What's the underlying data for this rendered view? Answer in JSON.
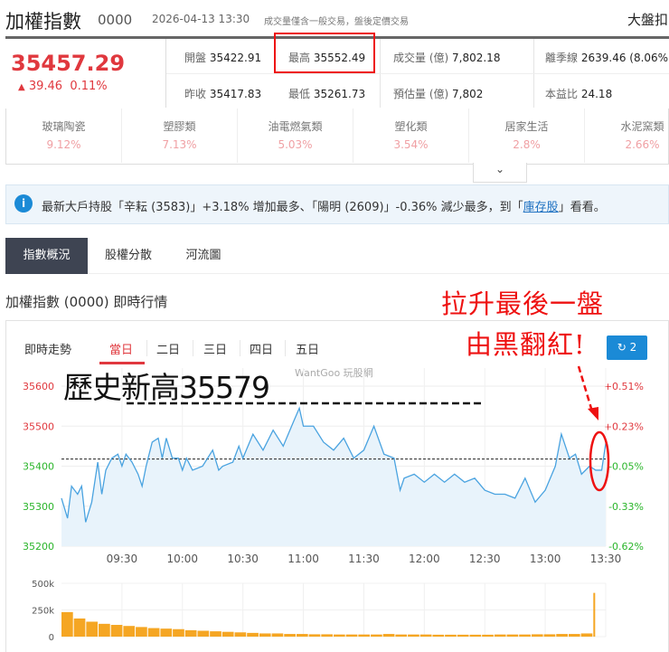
{
  "header": {
    "title": "加權指數",
    "code": "0000",
    "timestamp": "2026-04-13 13:30",
    "note": "成交量僅含一般交易，盤後定價交易",
    "right_cut": "大盤扣"
  },
  "quote": {
    "price": "35457.29",
    "change_arrow": "▲",
    "change": "39.46",
    "change_pct": "0.11%"
  },
  "stats": [
    {
      "label": "開盤",
      "value": "35422.91"
    },
    {
      "label": "最高",
      "value": "35552.49"
    },
    {
      "label": "成交量 (億)",
      "value": "7,802.18"
    },
    {
      "label": "離季線",
      "value": "2639.46 (8.06%"
    },
    {
      "label": "昨收",
      "value": "35417.83"
    },
    {
      "label": "最低",
      "value": "35261.73"
    },
    {
      "label": "預估量 (億)",
      "value": "7,802"
    },
    {
      "label": "本益比",
      "value": "24.18"
    }
  ],
  "sectors": [
    {
      "name": "玻璃陶瓷",
      "pct": "9.12%"
    },
    {
      "name": "塑膠類",
      "pct": "7.13%"
    },
    {
      "name": "油電燃氣類",
      "pct": "5.03%"
    },
    {
      "name": "塑化類",
      "pct": "3.54%"
    },
    {
      "name": "居家生活",
      "pct": "2.8%"
    },
    {
      "name": "水泥窯類",
      "pct": "2.66%"
    }
  ],
  "expand_icon": "chevron-down-icon",
  "info": {
    "icon": "i",
    "pre": "最新大戶持股「辛耘 (3583)」+3.18% 增加最多、「陽明 (2609)」-0.36% 減少最多，到「",
    "link": "庫存股",
    "post": "」看看。"
  },
  "tabs": [
    "指數概況",
    "股權分散",
    "河流圖"
  ],
  "section_title": "加權指數 (0000) 即時行情",
  "chart_header": {
    "label": "即時走勢",
    "ranges": [
      "當日",
      "二日",
      "三日",
      "四日",
      "五日"
    ],
    "refresh": "2"
  },
  "watermark": "WantGoo 玩股網",
  "annotations": {
    "high": "歷史新高35579",
    "line1": "拉升最後一盤",
    "line2": "由黑翻紅!"
  },
  "colors": {
    "up": "#e0383e",
    "down": "#2bb52b",
    "line": "#4aa3e0",
    "volume": "#f5a623",
    "accent": "#1b8ad6"
  },
  "chart_data": {
    "type": "line",
    "title": "即時走勢",
    "prev_close": 35417.83,
    "ylim": [
      35200,
      35600
    ],
    "y_ticks": [
      "35600",
      "35500",
      "35400",
      "35300",
      "35200"
    ],
    "y_pct_ticks": [
      "+0.51%",
      "+0.23%",
      "-0.05%",
      "-0.33%",
      "-0.62%"
    ],
    "x_ticks": [
      "09:30",
      "10:00",
      "10:30",
      "11:00",
      "11:30",
      "12:00",
      "12:30",
      "13:00",
      "13:30"
    ],
    "x_minutes_range": [
      0,
      270
    ],
    "series": [
      {
        "name": "加權指數",
        "points": [
          [
            0,
            35320
          ],
          [
            3,
            35270
          ],
          [
            5,
            35350
          ],
          [
            8,
            35330
          ],
          [
            10,
            35350
          ],
          [
            12,
            35260
          ],
          [
            15,
            35310
          ],
          [
            18,
            35410
          ],
          [
            20,
            35330
          ],
          [
            22,
            35390
          ],
          [
            25,
            35420
          ],
          [
            28,
            35430
          ],
          [
            30,
            35400
          ],
          [
            32,
            35430
          ],
          [
            35,
            35410
          ],
          [
            38,
            35380
          ],
          [
            40,
            35350
          ],
          [
            42,
            35400
          ],
          [
            45,
            35460
          ],
          [
            48,
            35470
          ],
          [
            50,
            35420
          ],
          [
            52,
            35470
          ],
          [
            55,
            35420
          ],
          [
            58,
            35420
          ],
          [
            60,
            35390
          ],
          [
            62,
            35420
          ],
          [
            65,
            35390
          ],
          [
            70,
            35400
          ],
          [
            75,
            35440
          ],
          [
            78,
            35390
          ],
          [
            80,
            35400
          ],
          [
            85,
            35410
          ],
          [
            88,
            35450
          ],
          [
            90,
            35420
          ],
          [
            95,
            35480
          ],
          [
            100,
            35440
          ],
          [
            105,
            35490
          ],
          [
            110,
            35450
          ],
          [
            115,
            35510
          ],
          [
            118,
            35545
          ],
          [
            120,
            35500
          ],
          [
            125,
            35500
          ],
          [
            130,
            35460
          ],
          [
            135,
            35440
          ],
          [
            140,
            35470
          ],
          [
            145,
            35420
          ],
          [
            150,
            35440
          ],
          [
            155,
            35500
          ],
          [
            160,
            35430
          ],
          [
            165,
            35420
          ],
          [
            168,
            35340
          ],
          [
            170,
            35370
          ],
          [
            175,
            35380
          ],
          [
            180,
            35360
          ],
          [
            185,
            35380
          ],
          [
            190,
            35360
          ],
          [
            195,
            35380
          ],
          [
            200,
            35360
          ],
          [
            205,
            35370
          ],
          [
            210,
            35340
          ],
          [
            215,
            35330
          ],
          [
            220,
            35330
          ],
          [
            225,
            35320
          ],
          [
            230,
            35370
          ],
          [
            235,
            35310
          ],
          [
            240,
            35340
          ],
          [
            245,
            35400
          ],
          [
            248,
            35480
          ],
          [
            252,
            35420
          ],
          [
            255,
            35430
          ],
          [
            258,
            35380
          ],
          [
            262,
            35400
          ],
          [
            265,
            35390
          ],
          [
            268,
            35390
          ],
          [
            270,
            35457
          ]
        ]
      }
    ],
    "volume": {
      "y_ticks": [
        "500k",
        "250k",
        "0"
      ],
      "ylim": [
        0,
        500
      ],
      "values_k": [
        230,
        170,
        140,
        120,
        110,
        100,
        90,
        80,
        75,
        70,
        60,
        55,
        50,
        45,
        40,
        35,
        30,
        30,
        25,
        25,
        22,
        22,
        20,
        20,
        20,
        20,
        25,
        20,
        20,
        20,
        18,
        18,
        18,
        18,
        18,
        20,
        20,
        20,
        22,
        22,
        25,
        25,
        30,
        410
      ]
    }
  }
}
